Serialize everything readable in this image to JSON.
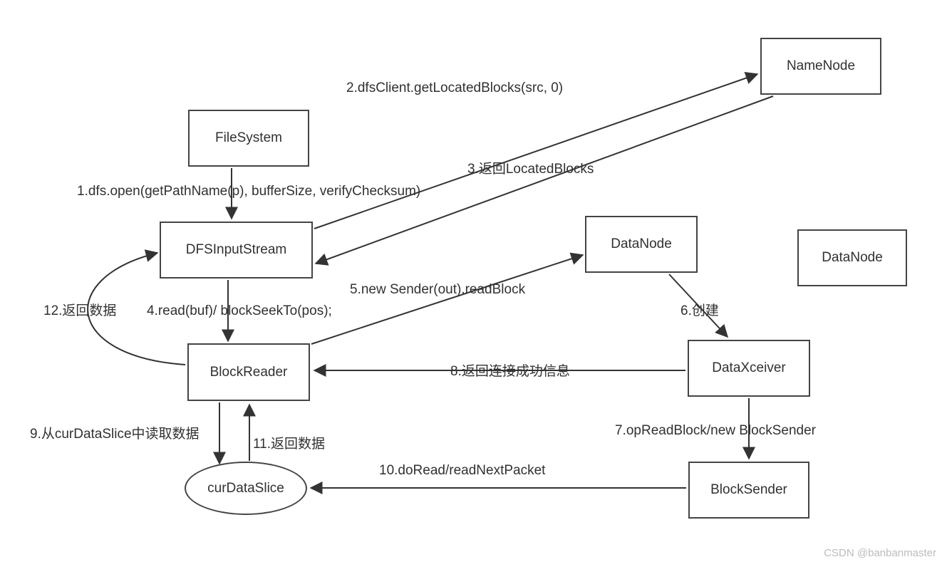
{
  "nodes": {
    "filesystem": {
      "label": "FileSystem"
    },
    "dfsinputstream": {
      "label": "DFSInputStream"
    },
    "blockreader": {
      "label": "BlockReader"
    },
    "curdataslice": {
      "label": "curDataSlice"
    },
    "namenode": {
      "label": "NameNode"
    },
    "datanode1": {
      "label": "DataNode"
    },
    "datanode2": {
      "label": "DataNode"
    },
    "dataxceiver": {
      "label": "DataXceiver"
    },
    "blocksender": {
      "label": "BlockSender"
    }
  },
  "edges": {
    "e1": {
      "label": "1.dfs.open(getPathName(p), bufferSize, verifyChecksum)"
    },
    "e2": {
      "label": "2.dfsClient.getLocatedBlocks(src, 0)"
    },
    "e3": {
      "label": "3.返回LocatedBlocks"
    },
    "e4": {
      "label": "4.read(buf)/ blockSeekTo(pos);"
    },
    "e5": {
      "label": "5.new Sender(out).readBlock"
    },
    "e6": {
      "label": "6.创建"
    },
    "e7": {
      "label": "7.opReadBlock/new BlockSender"
    },
    "e8": {
      "label": "8.返回连接成功信息"
    },
    "e9": {
      "label": "9.从curDataSlice中读取数据"
    },
    "e10": {
      "label": "10.doRead/readNextPacket"
    },
    "e11": {
      "label": "11.返回数据"
    },
    "e12": {
      "label": "12.返回数据"
    }
  },
  "watermark": "CSDN @banbanmaster"
}
